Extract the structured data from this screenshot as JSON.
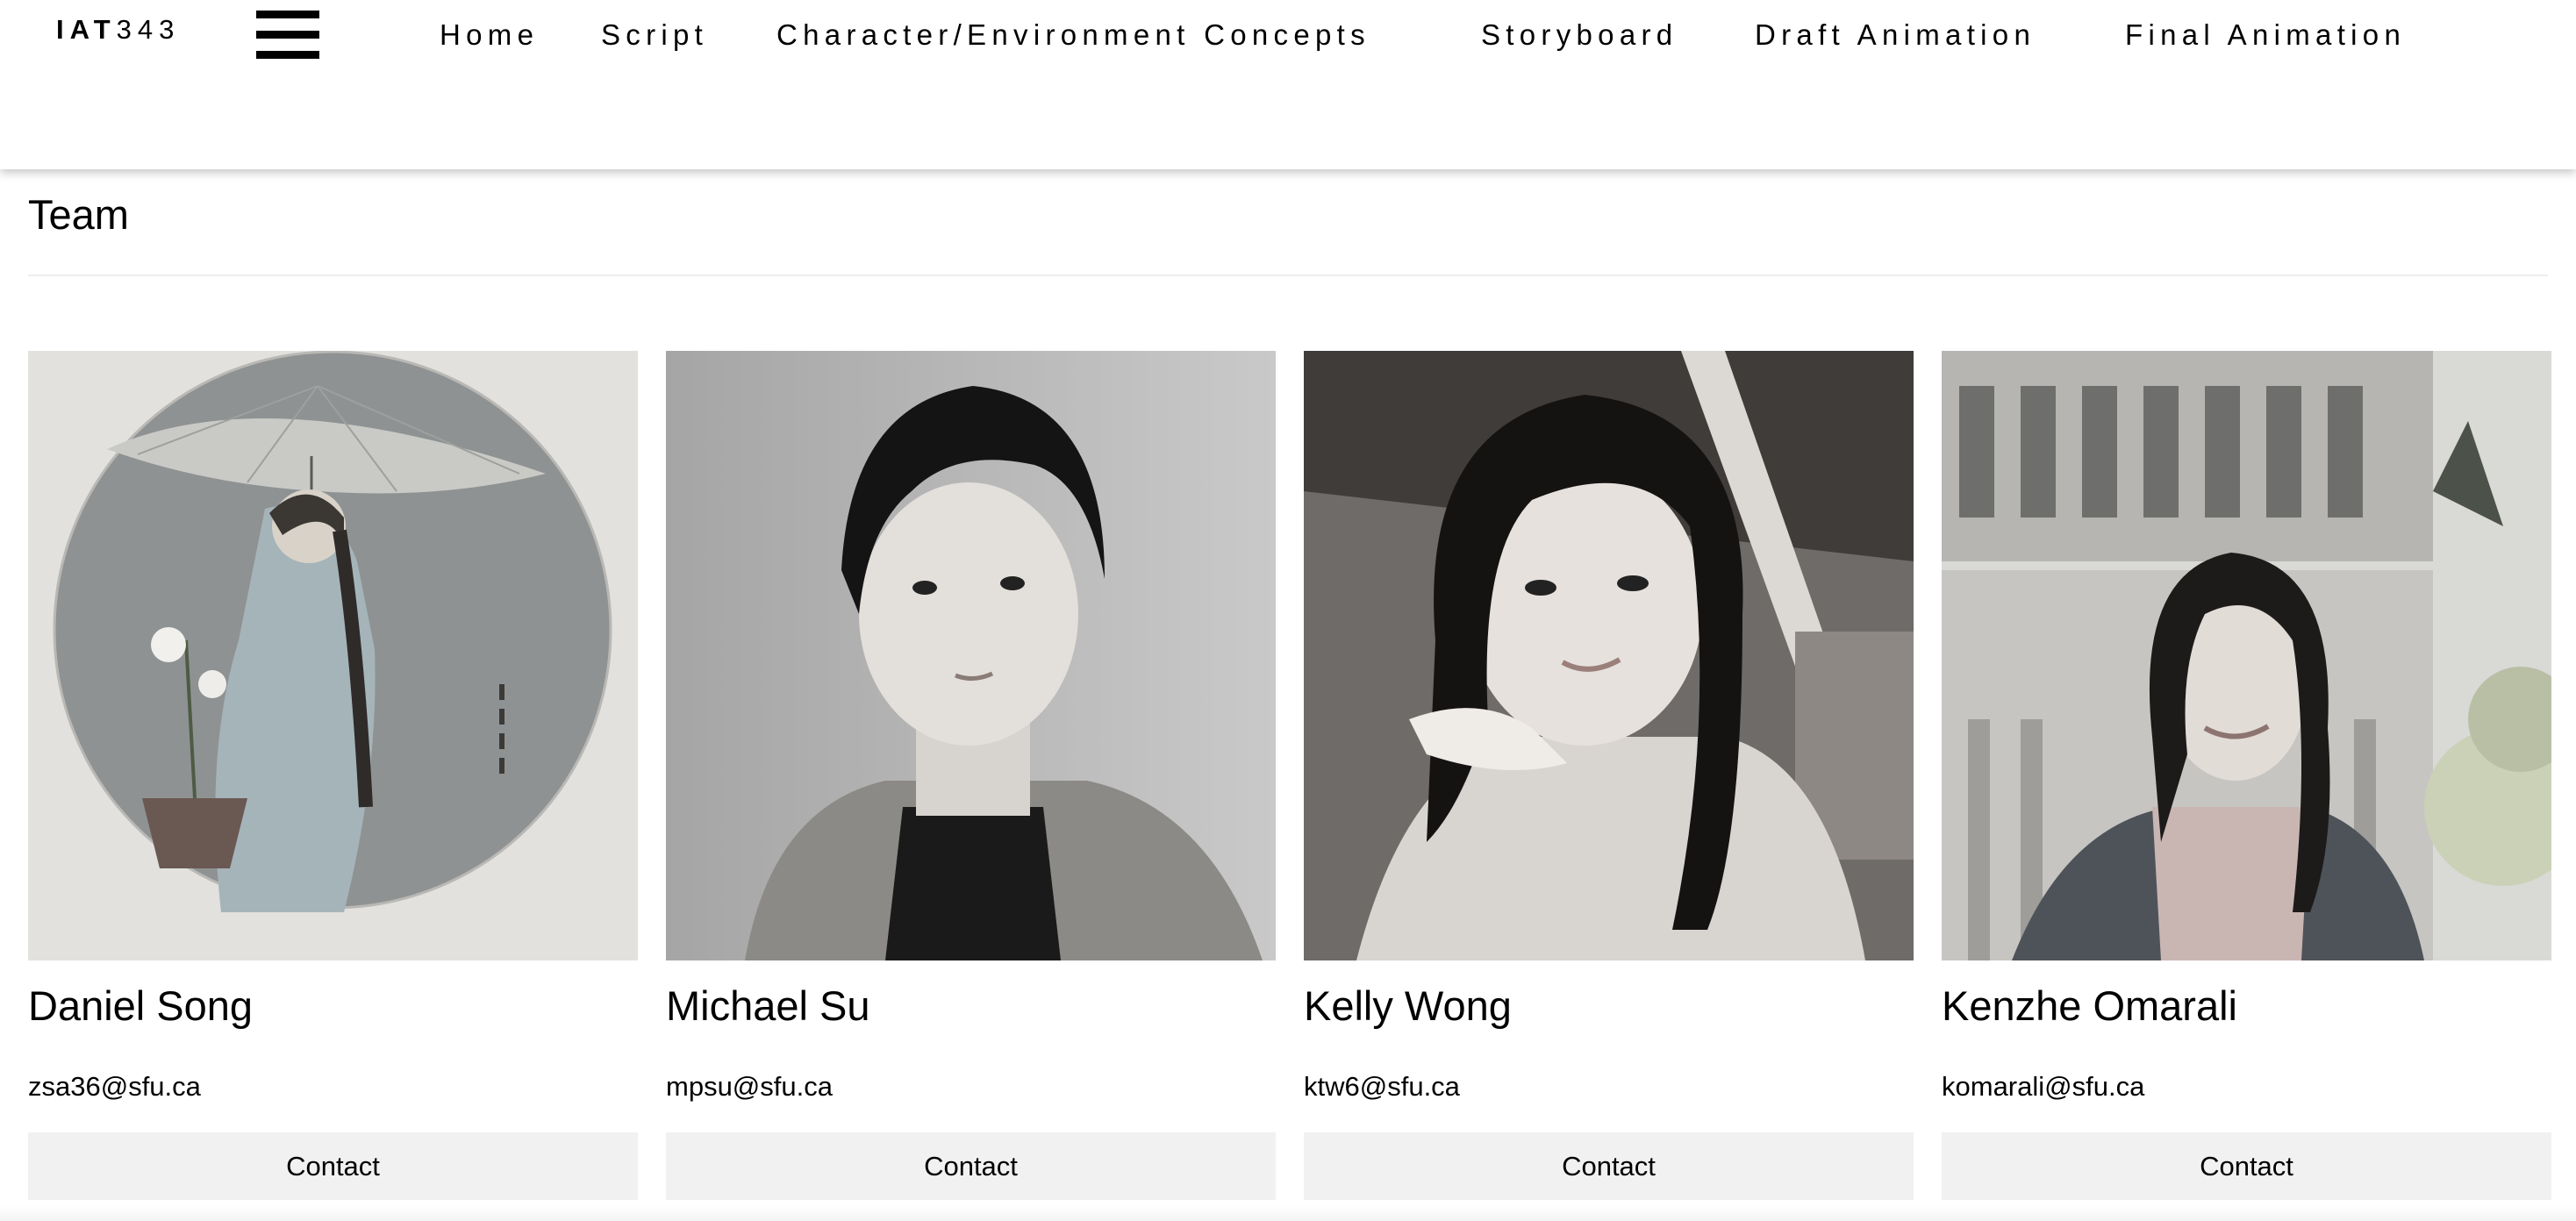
{
  "header": {
    "brand_bold": "IAT",
    "brand_light": "343",
    "menu_icon": "hamburger-menu-icon",
    "nav": [
      {
        "label": "Home"
      },
      {
        "label": "Script"
      },
      {
        "label": "Character/Environment Concepts"
      },
      {
        "label": "Storyboard"
      },
      {
        "label": "Draft Animation"
      },
      {
        "label": "Final Animation"
      }
    ]
  },
  "main": {
    "title": "Team",
    "members": [
      {
        "name": "Daniel Song",
        "email": "zsa36@sfu.ca",
        "contact_label": "Contact",
        "photo": "illustration of a girl holding an umbrella and a potted lily"
      },
      {
        "name": "Michael Su",
        "email": "mpsu@sfu.ca",
        "contact_label": "Contact",
        "photo": "black-and-white portrait"
      },
      {
        "name": "Kelly Wong",
        "email": "ktw6@sfu.ca",
        "contact_label": "Contact",
        "photo": "black-and-white portrait"
      },
      {
        "name": "Kenzhe Omarali",
        "email": "komarali@sfu.ca",
        "contact_label": "Contact",
        "photo": "black-and-white portrait"
      }
    ]
  },
  "colors": {
    "background": "#ffffff",
    "text": "#000000",
    "button_bg": "#f1f1f1",
    "divider": "#eeeeee"
  }
}
